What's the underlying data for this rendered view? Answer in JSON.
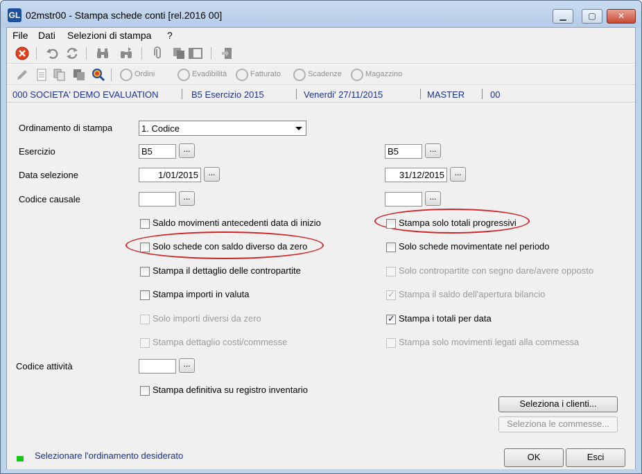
{
  "window": {
    "app_icon": "GL",
    "title": "02mstr00 - Stampa schede conti  [rel.2016 00]",
    "min_label": "▁",
    "max_label": "▢",
    "close_label": "✕"
  },
  "menu": [
    "File",
    "Dati",
    "Selezioni di stampa",
    "?"
  ],
  "toolbar2": {
    "ordini": "Ordini",
    "evadibilita": "Evadibilità",
    "fatturato": "Fatturato",
    "scadenze": "Scadenze",
    "magazzino": "Magazzino"
  },
  "info": {
    "company": "000 SOCIETA'  DEMO EVALUATION",
    "exercise": "B5 Esercizio 2015",
    "date": "Venerdi' 27/11/2015",
    "user": "MASTER",
    "code": "00"
  },
  "form": {
    "ordinamento_label": "Ordinamento di stampa",
    "ordinamento_value": "1. Codice",
    "esercizio_label": "Esercizio",
    "esercizio_from": "B5",
    "esercizio_to": "B5",
    "data_label": "Data selezione",
    "data_from": "1/01/2015",
    "data_to": "31/12/2015",
    "causale_label": "Codice causale",
    "causale_from": "",
    "causale_to": "",
    "attivita_label": "Codice attività",
    "attivita_value": "",
    "dots": "..."
  },
  "checkboxes": {
    "saldo_antecedenti": "Saldo movimenti antecedenti data di inizio",
    "solo_saldo_diverso": "Solo schede con saldo diverso da zero",
    "dettaglio_contropartite": "Stampa il dettaglio delle contropartite",
    "importi_valuta": "Stampa importi in valuta",
    "importi_diversi_zero": "Solo importi diversi da zero",
    "dettaglio_costi": "Stampa dettaglio costi/commesse",
    "totali_progressivi": "Stampa solo totali progressivi",
    "schede_movimentate": "Solo schede movimentate nel periodo",
    "contropartite_segno": "Solo contropartite con segno dare/avere opposto",
    "saldo_apertura": "Stampa il saldo dell'apertura bilancio",
    "totali_per_data": "Stampa i totali per data",
    "movimenti_commessa": "Stampa solo movimenti legati alla commessa",
    "definitiva_inventario": "Stampa definitiva su registro inventario",
    "check_mark": "✓"
  },
  "buttons": {
    "seleziona_clienti": "Seleziona i clienti...",
    "seleziona_commesse": "Seleziona le commesse...",
    "ok": "OK",
    "esci": "Esci"
  },
  "status": {
    "message": "Selezionare l'ordinamento desiderato",
    "led_color": "#17c617"
  },
  "colors": {
    "highlight_ellipse": "#d02424",
    "info_text": "#1b2f8f"
  }
}
